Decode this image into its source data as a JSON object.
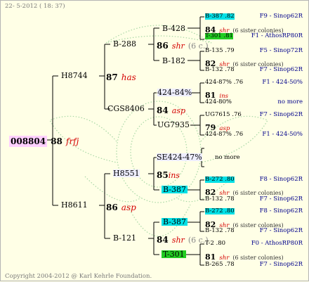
{
  "header": {
    "date": "22-  5-2012 ( 18: 37)"
  },
  "footer": {
    "copyright": "Copyright 2004-2012 @ Karl Kehrle Foundation."
  },
  "colors": {
    "background": "#ffffe6",
    "highlight_cyan": "#00e0e6",
    "highlight_green": "#22cc22",
    "queen_red": "#d40000",
    "source_blue": "#00008b",
    "root_pink": "#ffd0ff"
  },
  "root": {
    "id": "008804",
    "generation": "88",
    "breed": "frfj"
  },
  "gen1": {
    "upper": {
      "id": "H8744",
      "generation": "87",
      "breed": "has"
    },
    "lower": {
      "id": "H8611",
      "generation": "86",
      "breed": "asp"
    }
  },
  "gen2": {
    "b288": {
      "id": "B-288",
      "generation": "86",
      "breed": "shr",
      "colonies": "(6 c.)"
    },
    "cgs": {
      "id": "CGS8406",
      "generation": "84",
      "breed": "asp"
    },
    "h8551": {
      "id": "H8551",
      "generation": "85",
      "breed": "ins"
    },
    "b121": {
      "id": "B-121",
      "generation": "84",
      "breed": "shr",
      "colonies": "(6 c.)"
    }
  },
  "gen3": {
    "b428": "B-428",
    "b182": "B-182",
    "a424": "424-84%",
    "ug7935": "UG7935",
    "se424": "SE424-47%",
    "b387a": "B-387",
    "b387b": "B-387",
    "t301": "T-301"
  },
  "gen4": {
    "g1": {
      "top": "B-387 .82",
      "mid_gen": "84",
      "mid_breed": "shr",
      "mid_note": "(6 sister colonies)",
      "bottom": "T-301 .81",
      "src_top": "F9 - Sinop62R",
      "src_bottom": "F1 - AthosRP80R"
    },
    "g2": {
      "top": "B-135 .79",
      "mid_gen": "82",
      "mid_breed": "shr",
      "mid_note": "(6 sister colonies)",
      "bottom": "B-132 .78",
      "src_top": "F5 - Sinop72R",
      "src_bottom": "F7 - Sinop62R"
    },
    "g3": {
      "top": "424-87% .76",
      "mid_gen": "81",
      "mid_breed": "ins",
      "bottom": "424-80%",
      "src_top": "F1 - 424-50%",
      "src_bottom": "no more"
    },
    "g4": {
      "top": "UG7615 .76",
      "mid_gen": "79",
      "mid_breed": "asp",
      "bottom": "424-87% .76",
      "src_top": "F7 - Sinop62R",
      "src_bottom": "F1 - 424-50%"
    },
    "g5": {
      "note": "no more"
    },
    "g6": {
      "top": "B-272 .80",
      "mid_gen": "82",
      "mid_breed": "shr",
      "mid_note": "(6 sister colonies)",
      "bottom": "B-132 .78",
      "src_top": "F8 - Sinop62R",
      "src_bottom": "F7 - Sinop62R"
    },
    "g7": {
      "top": "B-272 .80",
      "mid_gen": "82",
      "mid_breed": "shr",
      "mid_note": "(6 sister colonies)",
      "bottom": "B-132 .78",
      "src_top": "F8 - Sinop62R",
      "src_bottom": "F7 - Sinop62R"
    },
    "g8": {
      "top": "T-2 .80",
      "mid_gen": "81",
      "mid_breed": "shr",
      "mid_note": "(6 sister colonies)",
      "bottom": "B-265 .78",
      "src_top": "F0 - AthosRP80R",
      "src_bottom": "F7 - Sinop62R"
    }
  }
}
